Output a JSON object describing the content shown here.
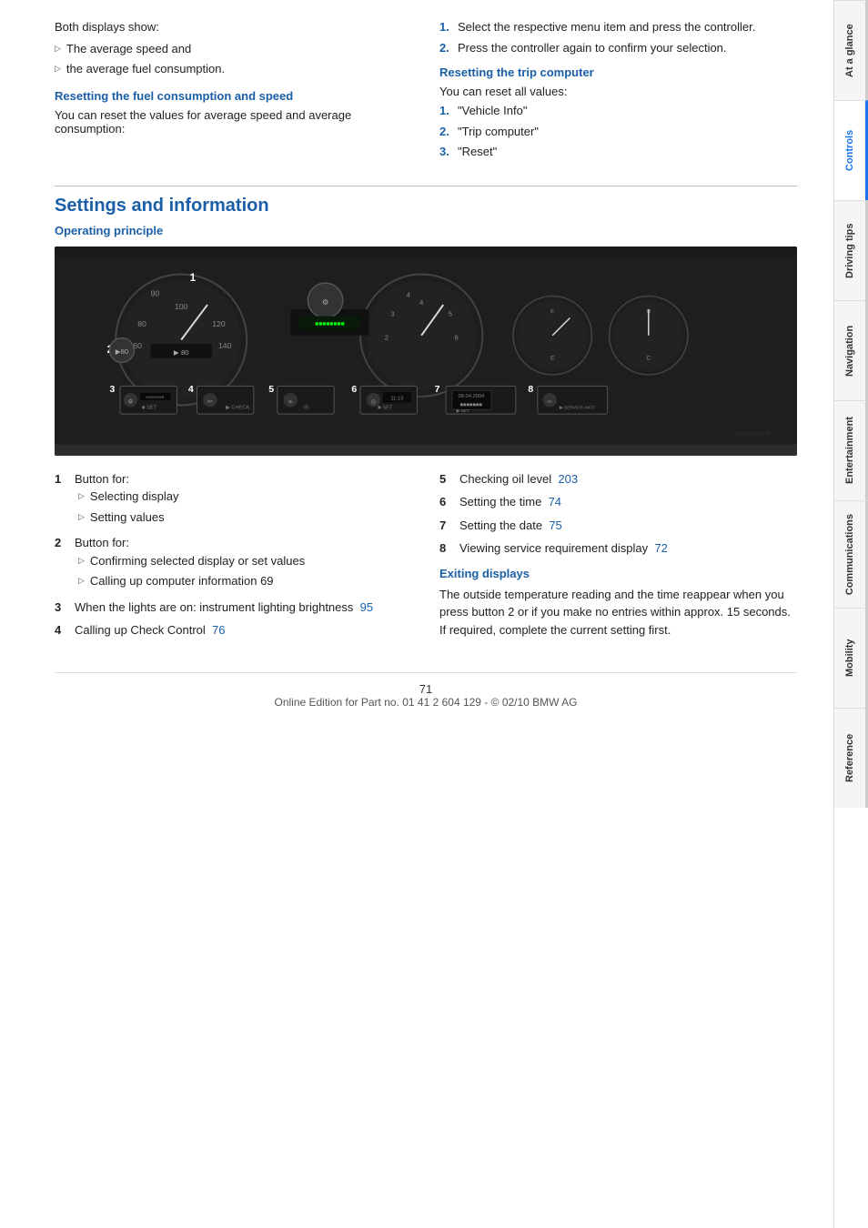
{
  "sidebar": {
    "tabs": [
      {
        "label": "At a glance",
        "active": false
      },
      {
        "label": "Controls",
        "active": true
      },
      {
        "label": "Driving tips",
        "active": false
      },
      {
        "label": "Navigation",
        "active": false
      },
      {
        "label": "Entertainment",
        "active": false
      },
      {
        "label": "Communications",
        "active": false
      },
      {
        "label": "Mobility",
        "active": false
      },
      {
        "label": "Reference",
        "active": false
      }
    ]
  },
  "top_left": {
    "intro": "Both displays show:",
    "bullets": [
      "The average speed and",
      "the average fuel consumption."
    ],
    "section_heading": "Resetting the fuel consumption and speed",
    "section_text": "You can reset the values for average speed and average consumption:"
  },
  "top_right": {
    "steps": [
      {
        "num": "1.",
        "text": "Select the respective menu item and press the controller."
      },
      {
        "num": "2.",
        "text": "Press the controller again to confirm your selection."
      }
    ],
    "trip_heading": "Resetting the trip computer",
    "trip_intro": "You can reset all values:",
    "trip_steps": [
      {
        "num": "1.",
        "text": "\"Vehicle Info\""
      },
      {
        "num": "2.",
        "text": "\"Trip computer\""
      },
      {
        "num": "3.",
        "text": "\"Reset\""
      }
    ]
  },
  "main_heading": "Settings and information",
  "operating_heading": "Operating principle",
  "dashboard": {
    "items": [
      {
        "num": "3",
        "icon": "gear",
        "label": "SET"
      },
      {
        "num": "4",
        "icon": "arrow",
        "label": "CHECK"
      },
      {
        "num": "5",
        "icon": "menu",
        "label": "IS"
      },
      {
        "num": "6",
        "icon": "circle",
        "label": "SET"
      },
      {
        "num": "7",
        "icon": "display",
        "label": "SET"
      },
      {
        "num": "8",
        "icon": "arrow",
        "label": "SERVICE-INFO"
      }
    ]
  },
  "descriptions": {
    "left": [
      {
        "num": "1",
        "title": "Button for:",
        "bullets": [
          "Selecting display",
          "Setting values"
        ]
      },
      {
        "num": "2",
        "title": "Button for:",
        "bullets": [
          "Confirming selected display or set values",
          "Calling up computer information  69"
        ]
      },
      {
        "num": "3",
        "title": "When the lights are on: instrument lighting brightness",
        "link": "95"
      },
      {
        "num": "4",
        "title": "Calling up Check Control",
        "link": "76"
      }
    ],
    "right": [
      {
        "num": "5",
        "title": "Checking oil level",
        "link": "203"
      },
      {
        "num": "6",
        "title": "Setting the time",
        "link": "74"
      },
      {
        "num": "7",
        "title": "Setting the date",
        "link": "75"
      },
      {
        "num": "8",
        "title": "Viewing service requirement display",
        "link": "72"
      }
    ]
  },
  "exiting": {
    "heading": "Exiting displays",
    "text": "The outside temperature reading and the time reappear when you press button 2 or if you make no entries within approx. 15 seconds. If required, complete the current setting first."
  },
  "footer": {
    "page_num": "71",
    "copyright": "Online Edition for Part no. 01 41 2 604 129 - © 02/10 BMW AG"
  }
}
